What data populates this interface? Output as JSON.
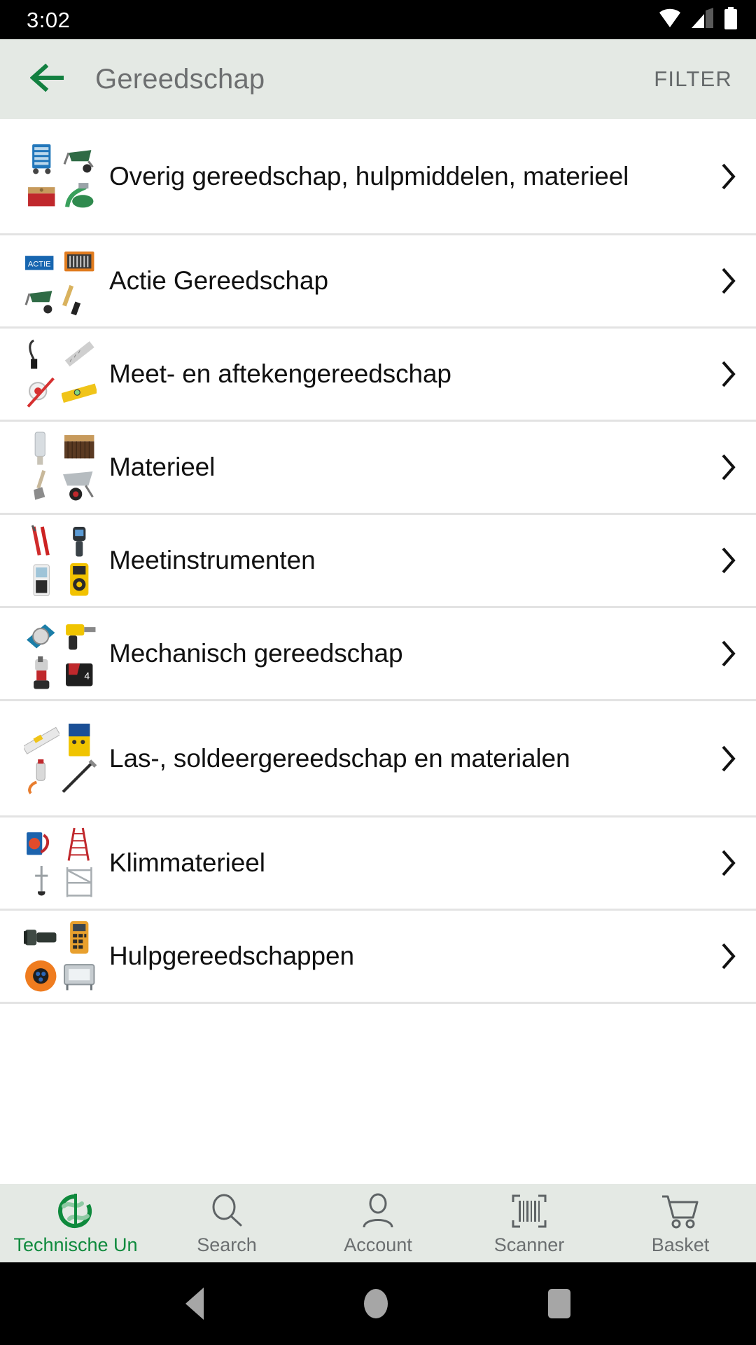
{
  "status_bar": {
    "time": "3:02",
    "icons": [
      "wifi-icon",
      "cellular-signal-icon",
      "battery-icon"
    ]
  },
  "app_bar": {
    "back_icon": "arrow-left-icon",
    "title": "Gereedschap",
    "filter_label": "FILTER",
    "background_color": "#e4e9e4",
    "title_color": "#6d6f70",
    "accent_color": "#0f8a3d"
  },
  "list": {
    "chevron_icon": "chevron-right-icon",
    "items": [
      {
        "label": "Overig gereedschap, hulpmiddelen, materieel",
        "thumb": "toolbox-wheelbarrow-broom-hose-reel"
      },
      {
        "label": "Actie Gereedschap",
        "thumb": "actie-promo-bitset-wheelbarrow"
      },
      {
        "label": "Meet- en aftekengereedschap",
        "thumb": "tape-measure-spirit-level-ruler"
      },
      {
        "label": "Materieel",
        "thumb": "broom-shovel-wheelbarrow"
      },
      {
        "label": "Meetinstrumenten",
        "thumb": "multimeter-thermometer-probes"
      },
      {
        "label": "Mechanisch gereedschap",
        "thumb": "circular-saw-drill-battery"
      },
      {
        "label": "Las-, soldeergereedschap en materialen",
        "thumb": "welder-torch-soldering"
      },
      {
        "label": "Klimmaterieel",
        "thumb": "ladder-scaffold-harness"
      },
      {
        "label": "Hulpgereedschappen",
        "thumb": "flashlight-labelmaker-cable-reel"
      }
    ]
  },
  "bottom_nav": {
    "items": [
      {
        "label": "Technische Un",
        "icon": "technische-unie-logo-icon",
        "active": true
      },
      {
        "label": "Search",
        "icon": "search-icon",
        "active": false
      },
      {
        "label": "Account",
        "icon": "person-icon",
        "active": false
      },
      {
        "label": "Scanner",
        "icon": "barcode-scanner-icon",
        "active": false
      },
      {
        "label": "Basket",
        "icon": "shopping-cart-icon",
        "active": false
      }
    ],
    "active_color": "#0f8a3d",
    "inactive_color": "#6b6f70",
    "background_color": "#e4e9e4"
  },
  "system_nav": {
    "buttons": [
      "back-triangle-icon",
      "home-circle-icon",
      "recents-square-icon"
    ]
  }
}
